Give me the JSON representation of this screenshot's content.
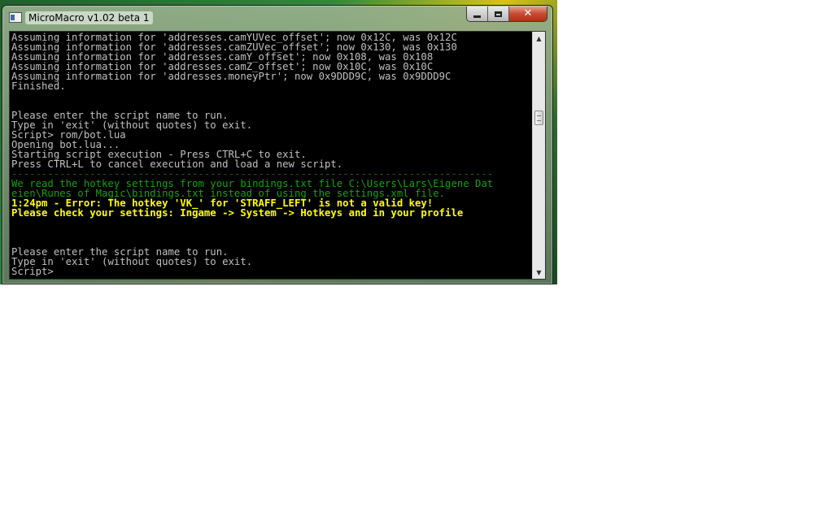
{
  "window": {
    "title": "MicroMacro v1.02 beta 1",
    "minimize_glyph": "",
    "close_glyph": "✕"
  },
  "console": {
    "lines": [
      {
        "text": "Assuming information for 'addresses.camYUVec_offset'; now 0x12C, was 0x12C",
        "style": "normal"
      },
      {
        "text": "Assuming information for 'addresses.camZUVec_offset'; now 0x130, was 0x130",
        "style": "normal"
      },
      {
        "text": "Assuming information for 'addresses.camY_offset'; now 0x108, was 0x108",
        "style": "normal"
      },
      {
        "text": "Assuming information for 'addresses.camZ_offset'; now 0x10C, was 0x10C",
        "style": "normal"
      },
      {
        "text": "Assuming information for 'addresses.moneyPtr'; now 0x9DDD9C, was 0x9DDD9C",
        "style": "normal"
      },
      {
        "text": "Finished.",
        "style": "normal"
      },
      {
        "text": "",
        "style": "normal"
      },
      {
        "text": "",
        "style": "normal"
      },
      {
        "text": "Please enter the script name to run.",
        "style": "normal"
      },
      {
        "text": "Type in 'exit' (without quotes) to exit.",
        "style": "normal"
      },
      {
        "text": "Script> rom/bot.lua",
        "style": "normal"
      },
      {
        "text": "Opening bot.lua...",
        "style": "normal"
      },
      {
        "text": "Starting script execution - Press CTRL+C to exit.",
        "style": "normal"
      },
      {
        "text": "Press CTRL+L to cancel execution and load a new script.",
        "style": "normal"
      },
      {
        "text": "--------------------------------------------------------------------------------",
        "style": "rule"
      },
      {
        "text": "We read the hotkey settings from your bindings.txt file C:\\Users\\Lars\\Eigene Dat",
        "style": "green"
      },
      {
        "text": "eien\\Runes of Magic\\bindings.txt instead of using the settings.xml file.",
        "style": "green"
      },
      {
        "text": "1:24pm - Error: The hotkey 'VK_' for 'STRAFF_LEFT' is not a valid key!",
        "style": "yellow"
      },
      {
        "text": "Please check your settings: Ingame -> System -> Hotkeys and in your profile",
        "style": "yellow"
      },
      {
        "text": "",
        "style": "normal"
      },
      {
        "text": "",
        "style": "normal"
      },
      {
        "text": "",
        "style": "normal"
      },
      {
        "text": "Please enter the script name to run.",
        "style": "normal"
      },
      {
        "text": "Type in 'exit' (without quotes) to exit.",
        "style": "normal"
      },
      {
        "text": "Script>",
        "style": "normal"
      }
    ]
  },
  "scrollbar": {
    "position_fraction": 0.32
  },
  "colors": {
    "console_background": "#000000",
    "normal_text": "#c0c0c0",
    "green_text": "#13a10e",
    "yellow_text": "#ffff00",
    "close_button": "#c84a32"
  },
  "icons": {
    "app": "console-app-icon",
    "minimize": "minimize-icon",
    "maximize": "maximize-icon",
    "close": "close-icon",
    "scroll_up": "scroll-up-arrow-icon",
    "scroll_down": "scroll-down-arrow-icon"
  }
}
